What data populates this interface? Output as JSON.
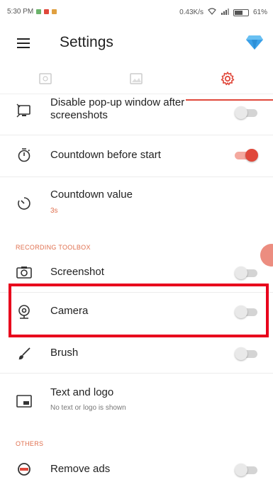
{
  "status_bar": {
    "time": "5:30 PM",
    "network": "0.43K/s",
    "battery": "61%"
  },
  "app_bar": {
    "title": "Settings",
    "menu_icon": "hamburger-menu-icon",
    "premium_icon": "diamond-icon"
  },
  "tabs": [
    {
      "icon": "video-settings-icon",
      "active": false
    },
    {
      "icon": "image-settings-icon",
      "active": false
    },
    {
      "icon": "gear-icon",
      "active": true
    }
  ],
  "settings": {
    "disable_popup": {
      "title_line1": "Disable pop-up window after",
      "title_line2": "screenshots",
      "enabled": false
    },
    "countdown_before_start": {
      "title": "Countdown before start",
      "enabled": true
    },
    "countdown_value": {
      "title": "Countdown value",
      "value": "3s"
    },
    "recording_toolbox_header": "RECORDING TOOLBOX",
    "screenshot": {
      "title": "Screenshot",
      "enabled": false
    },
    "camera": {
      "title": "Camera",
      "enabled": false
    },
    "brush": {
      "title": "Brush",
      "enabled": false
    },
    "text_logo": {
      "title": "Text and logo",
      "subtitle": "No text or logo is shown"
    },
    "others_header": "OTHERS",
    "remove_ads": {
      "title": "Remove ads",
      "enabled": false
    }
  },
  "colors": {
    "accent": "#e0483b",
    "highlight_box": "#e8001c"
  }
}
